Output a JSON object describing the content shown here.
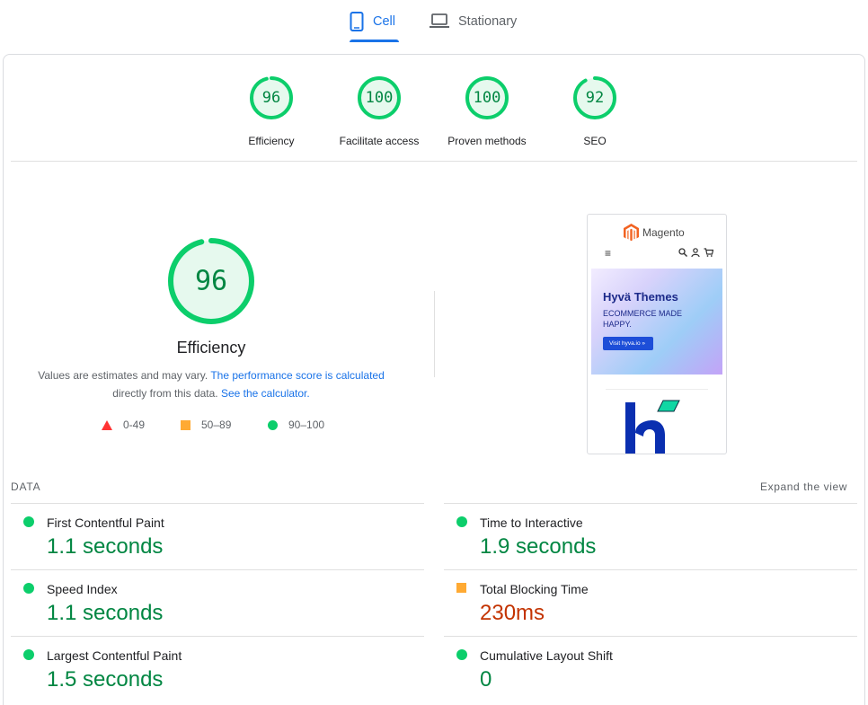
{
  "tabs": [
    {
      "label": "Cell",
      "icon": "phone-icon",
      "active": true
    },
    {
      "label": "Stationary",
      "icon": "laptop-icon",
      "active": false
    }
  ],
  "categories": [
    {
      "score": 96,
      "label": "Efficiency"
    },
    {
      "score": 100,
      "label": "Facilitate access"
    },
    {
      "score": 100,
      "label": "Proven methods"
    },
    {
      "score": 92,
      "label": "SEO"
    }
  ],
  "summary": {
    "score": 96,
    "title": "Efficiency",
    "desc_text1": "Values are estimates and may vary. ",
    "desc_link1": "The performance score is calculated",
    "desc_text2": "directly from this data. ",
    "desc_link2": "See the calculator."
  },
  "legend": {
    "fail": "0-49",
    "average": "50–89",
    "pass": "90–100"
  },
  "preview": {
    "brand": "Magento",
    "hero_title": "Hyvä Themes",
    "hero_sub": "ECOMMERCE MADE HAPPY.",
    "hero_button": "Visit hyva.io »"
  },
  "data": {
    "title": "DATA",
    "expand": "Expand the view",
    "metrics": [
      {
        "name": "First Contentful Paint",
        "value": "1.1 seconds",
        "rating": "good"
      },
      {
        "name": "Time to Interactive",
        "value": "1.9 seconds",
        "rating": "good"
      },
      {
        "name": "Speed Index",
        "value": "1.1 seconds",
        "rating": "good"
      },
      {
        "name": "Total Blocking Time",
        "value": "230ms",
        "rating": "average"
      },
      {
        "name": "Largest Contentful Paint",
        "value": "1.5 seconds",
        "rating": "good"
      },
      {
        "name": "Cumulative Layout Shift",
        "value": "0",
        "rating": "good"
      }
    ]
  },
  "colors": {
    "accent": "#1a73e8",
    "pass": "#0cce6b",
    "pass_text": "#018642",
    "average": "#ffaa33",
    "average_text": "#c33300",
    "fail": "#ff3333"
  }
}
